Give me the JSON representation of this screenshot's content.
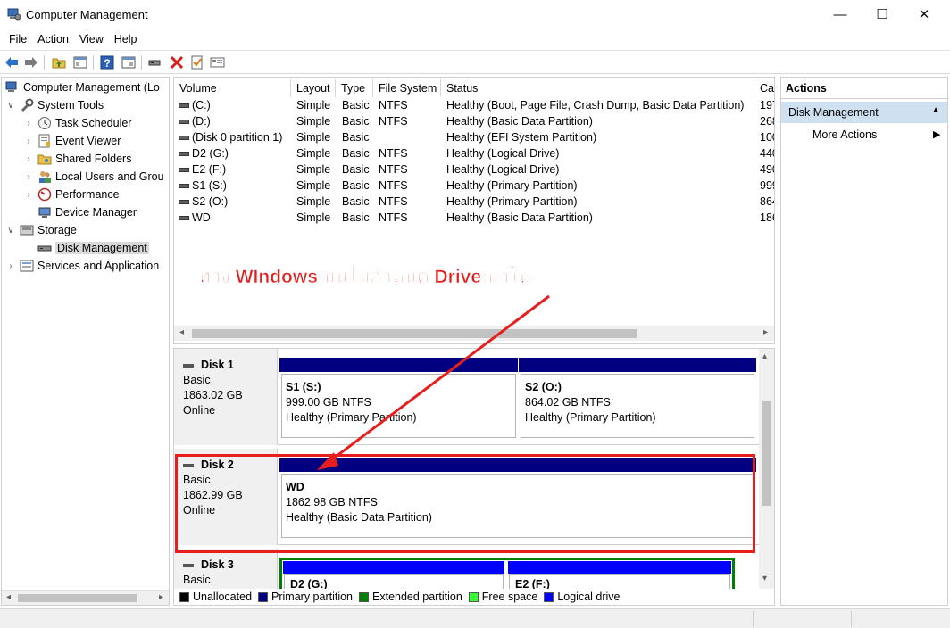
{
  "window": {
    "title": "Computer Management",
    "minimize": "—",
    "maximize": "☐",
    "close": "✕"
  },
  "menu": [
    "File",
    "Action",
    "View",
    "Help"
  ],
  "tree": {
    "items": [
      {
        "label": "Computer Management (Lo",
        "icon": "computer-management-icon",
        "chevron": ""
      },
      {
        "label": "System Tools",
        "icon": "tools-icon",
        "chevron": "⌵"
      },
      {
        "label": "Task Scheduler",
        "icon": "clock-icon",
        "chevron": "›"
      },
      {
        "label": "Event Viewer",
        "icon": "event-viewer-icon",
        "chevron": "›"
      },
      {
        "label": "Shared Folders",
        "icon": "shared-folder-icon",
        "chevron": "›"
      },
      {
        "label": "Local Users and Grou",
        "icon": "users-icon",
        "chevron": "›"
      },
      {
        "label": "Performance",
        "icon": "performance-icon",
        "chevron": "›"
      },
      {
        "label": "Device Manager",
        "icon": "device-manager-icon",
        "chevron": ""
      },
      {
        "label": "Storage",
        "icon": "storage-icon",
        "chevron": "⌵"
      },
      {
        "label": "Disk Management",
        "icon": "disk-icon",
        "chevron": ""
      },
      {
        "label": "Services and Application",
        "icon": "services-icon",
        "chevron": "›"
      }
    ]
  },
  "volumes": {
    "headers": [
      "Volume",
      "Layout",
      "Type",
      "File System",
      "Status",
      "Cap"
    ],
    "rows": [
      [
        "(C:)",
        "Simple",
        "Basic",
        "NTFS",
        "Healthy (Boot, Page File, Crash Dump, Basic Data Partition)",
        "197"
      ],
      [
        "(D:)",
        "Simple",
        "Basic",
        "NTFS",
        "Healthy (Basic Data Partition)",
        "268"
      ],
      [
        "(Disk 0 partition 1)",
        "Simple",
        "Basic",
        "",
        "Healthy (EFI System Partition)",
        "100"
      ],
      [
        "D2 (G:)",
        "Simple",
        "Basic",
        "NTFS",
        "Healthy (Logical Drive)",
        "440"
      ],
      [
        "E2 (F:)",
        "Simple",
        "Basic",
        "NTFS",
        "Healthy (Logical Drive)",
        "490"
      ],
      [
        "S1 (S:)",
        "Simple",
        "Basic",
        "NTFS",
        "Healthy (Primary Partition)",
        "999"
      ],
      [
        "S2 (O:)",
        "Simple",
        "Basic",
        "NTFS",
        "Healthy (Primary Partition)",
        "864"
      ],
      [
        "WD",
        "Simple",
        "Basic",
        "NTFS",
        "Healthy (Basic Data Partition)",
        "186"
      ]
    ]
  },
  "disks": [
    {
      "name": "Disk 1",
      "type": "Basic",
      "size": "1863.02 GB",
      "state": "Online",
      "partitions": [
        {
          "name": "S1  (S:)",
          "size": "999.00 GB NTFS",
          "status": "Healthy (Primary Partition)"
        },
        {
          "name": "S2  (O:)",
          "size": "864.02 GB NTFS",
          "status": "Healthy (Primary Partition)"
        }
      ]
    },
    {
      "name": "Disk 2",
      "type": "Basic",
      "size": "1862.99 GB",
      "state": "Online",
      "partitions": [
        {
          "name": "WD",
          "size": "1862.98 GB NTFS",
          "status": "Healthy (Basic Data Partition)"
        }
      ]
    },
    {
      "name": "Disk 3",
      "type": "Basic",
      "partitions": [
        {
          "name": "D2  (G:)"
        },
        {
          "name": "E2  (F:)"
        }
      ]
    }
  ],
  "legend": [
    {
      "label": "Unallocated",
      "color": "#000000"
    },
    {
      "label": "Primary partition",
      "color": "#000080"
    },
    {
      "label": "Extended partition",
      "color": "#008000"
    },
    {
      "label": "Free space",
      "color": "#33ff33"
    },
    {
      "label": "Logical drive",
      "color": "#0000ff"
    }
  ],
  "actions": {
    "header": "Actions",
    "section": "Disk Management",
    "items": [
      "More Actions"
    ]
  },
  "annotation": {
    "text": "ทาง WIndows มันไม่กำหนด Drive มาให้",
    "color": "#e41e1e"
  }
}
